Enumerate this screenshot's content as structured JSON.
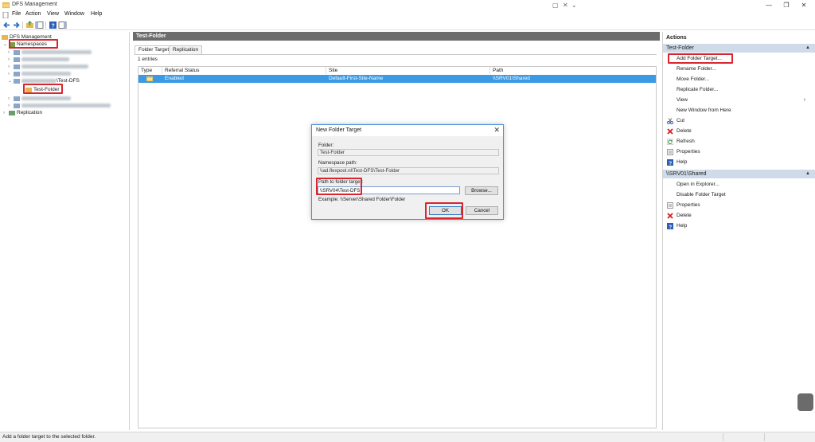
{
  "window": {
    "title": "DFS Management"
  },
  "menu": [
    "File",
    "Action",
    "View",
    "Window",
    "Help"
  ],
  "tree": {
    "root": "DFS Management",
    "namespaces": "Namespaces",
    "namespace_suffix": "\\Test-DFS",
    "folder": "Test-Folder",
    "replication": "Replication"
  },
  "center": {
    "header": "Test-Folder",
    "tabs": [
      "Folder Targets",
      "Replication"
    ],
    "entries_count": "1 entries",
    "columns": [
      "Type",
      "Referral Status",
      "Site",
      "Path"
    ],
    "rows": [
      {
        "referral_status": "Enabled",
        "site": "Default-First-Site-Name",
        "path": "\\\\SRV01\\Shared"
      }
    ]
  },
  "dialog": {
    "title": "New Folder Target",
    "folder_label": "Folder:",
    "folder_value": "Test-Folder",
    "namespace_label": "Namespace path:",
    "namespace_value": "\\\\ad.flexpool.nl\\Test-DFS\\Test-Folder",
    "path_label": "Path to folder target:",
    "path_value": "\\\\SRV04\\Test-DFS",
    "browse_label": "Browse...",
    "example": "Example: \\\\Server\\Shared Folder\\Folder",
    "ok_label": "OK",
    "cancel_label": "Cancel"
  },
  "actions": {
    "title": "Actions",
    "section1": {
      "header": "Test-Folder",
      "items": [
        "Add Folder Target...",
        "Rename Folder...",
        "Move Folder...",
        "Replicate Folder...",
        "View",
        "New Window from Here",
        "Cut",
        "Delete",
        "Refresh",
        "Properties",
        "Help"
      ]
    },
    "section2": {
      "header": "\\\\SRV01\\Shared",
      "items": [
        "Open in Explorer...",
        "Disable Folder Target",
        "Properties",
        "Delete",
        "Help"
      ]
    }
  },
  "status": {
    "text": "Add a folder target to the selected folder."
  },
  "colors": {
    "selection": "#3b9ae3",
    "highlight_box": "#d9262e",
    "header_dark": "#6c6c6c",
    "section_blue": "#cfdbe8"
  }
}
